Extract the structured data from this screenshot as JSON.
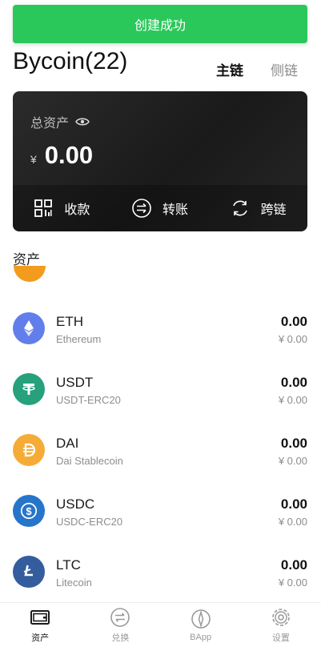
{
  "toast": {
    "message": "创建成功"
  },
  "header": {
    "wallet_title": "Bycoin(22)",
    "tabs": [
      {
        "label": "主链",
        "active": true
      },
      {
        "label": "侧链",
        "active": false
      }
    ]
  },
  "card": {
    "label": "总资产",
    "currency_symbol": "¥",
    "balance": "0.00",
    "actions": [
      {
        "label": "收款",
        "icon": "qr-code-icon"
      },
      {
        "label": "转账",
        "icon": "transfer-icon"
      },
      {
        "label": "跨链",
        "icon": "cross-chain-icon"
      }
    ]
  },
  "assets_section": {
    "title": "资产"
  },
  "assets": [
    {
      "symbol": "ETH",
      "name": "Ethereum",
      "amount": "0.00",
      "value": "¥ 0.00",
      "icon": "eth-icon",
      "color": "#627eea"
    },
    {
      "symbol": "USDT",
      "name": "USDT-ERC20",
      "amount": "0.00",
      "value": "¥ 0.00",
      "icon": "usdt-icon",
      "color": "#26a17b"
    },
    {
      "symbol": "DAI",
      "name": "Dai Stablecoin",
      "amount": "0.00",
      "value": "¥ 0.00",
      "icon": "dai-icon",
      "color": "#f5ac37"
    },
    {
      "symbol": "USDC",
      "name": "USDC-ERC20",
      "amount": "0.00",
      "value": "¥ 0.00",
      "icon": "usdc-icon",
      "color": "#2775ca"
    },
    {
      "symbol": "LTC",
      "name": "Litecoin",
      "amount": "0.00",
      "value": "¥ 0.00",
      "icon": "ltc-icon",
      "color": "#345d9d"
    }
  ],
  "tabbar": [
    {
      "label": "资产",
      "icon": "wallet-icon",
      "active": true
    },
    {
      "label": "兑换",
      "icon": "exchange-icon",
      "active": false
    },
    {
      "label": "BApp",
      "icon": "compass-icon",
      "active": false
    },
    {
      "label": "设置",
      "icon": "gear-icon",
      "active": false
    }
  ]
}
